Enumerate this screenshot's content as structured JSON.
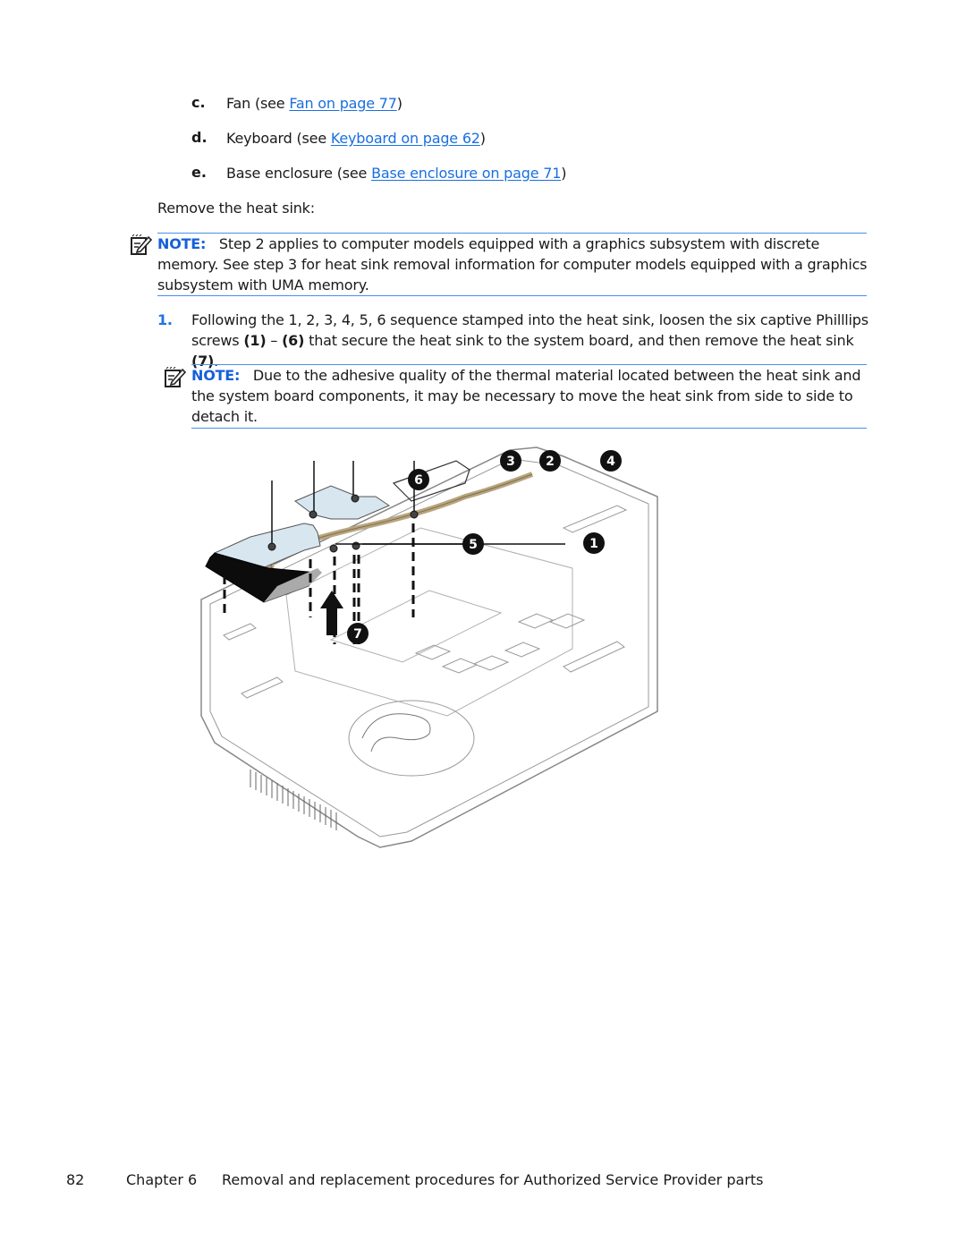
{
  "prereq_items": [
    {
      "letter": "c.",
      "text_before": "Fan (see ",
      "link": "Fan on page 77",
      "text_after": ")"
    },
    {
      "letter": "d.",
      "text_before": "Keyboard (see ",
      "link": "Keyboard on page 62",
      "text_after": ")"
    },
    {
      "letter": "e.",
      "text_before": "Base enclosure (see ",
      "link": "Base enclosure on page 71",
      "text_after": ")"
    }
  ],
  "intro": "Remove the heat sink:",
  "note1": {
    "label": "NOTE:",
    "line1": "Step 2 applies to computer models equipped with a graphics subsystem with discrete",
    "line2": "memory. See step 3 for heat sink removal information for computer models equipped with a graphics",
    "line3": "subsystem with UMA memory."
  },
  "step1": {
    "number": "1.",
    "line1": "Following the 1, 2, 3, 4, 5, 6 sequence stamped into the heat sink, loosen the six captive Philllips",
    "line2_a": "screws ",
    "line2_b": "(1)",
    "line2_c": " – ",
    "line2_d": "(6)",
    "line2_e": " that secure the heat sink to the system board, and then remove the heat sink ",
    "line2_f": "(7)",
    "line2_g": "."
  },
  "note2": {
    "label": "NOTE:",
    "line1": "Due to the adhesive quality of the thermal material located between the heat sink and",
    "line2": "the system board components, it may be necessary to move the heat sink from side to side to",
    "line3": "detach it."
  },
  "illustration": {
    "description": "Heat sink removal illustration",
    "callouts": [
      "1",
      "2",
      "3",
      "4",
      "5",
      "6",
      "7"
    ]
  },
  "footer": {
    "page_number": "82",
    "chapter": "Chapter 6",
    "title": "Removal and replacement procedures for Authorized Service Provider parts"
  },
  "colors": {
    "link": "#1a6fe0",
    "note_rule": "#4a8fe6",
    "note_label": "#1560d9",
    "heatpipe": "#b8a57e"
  }
}
